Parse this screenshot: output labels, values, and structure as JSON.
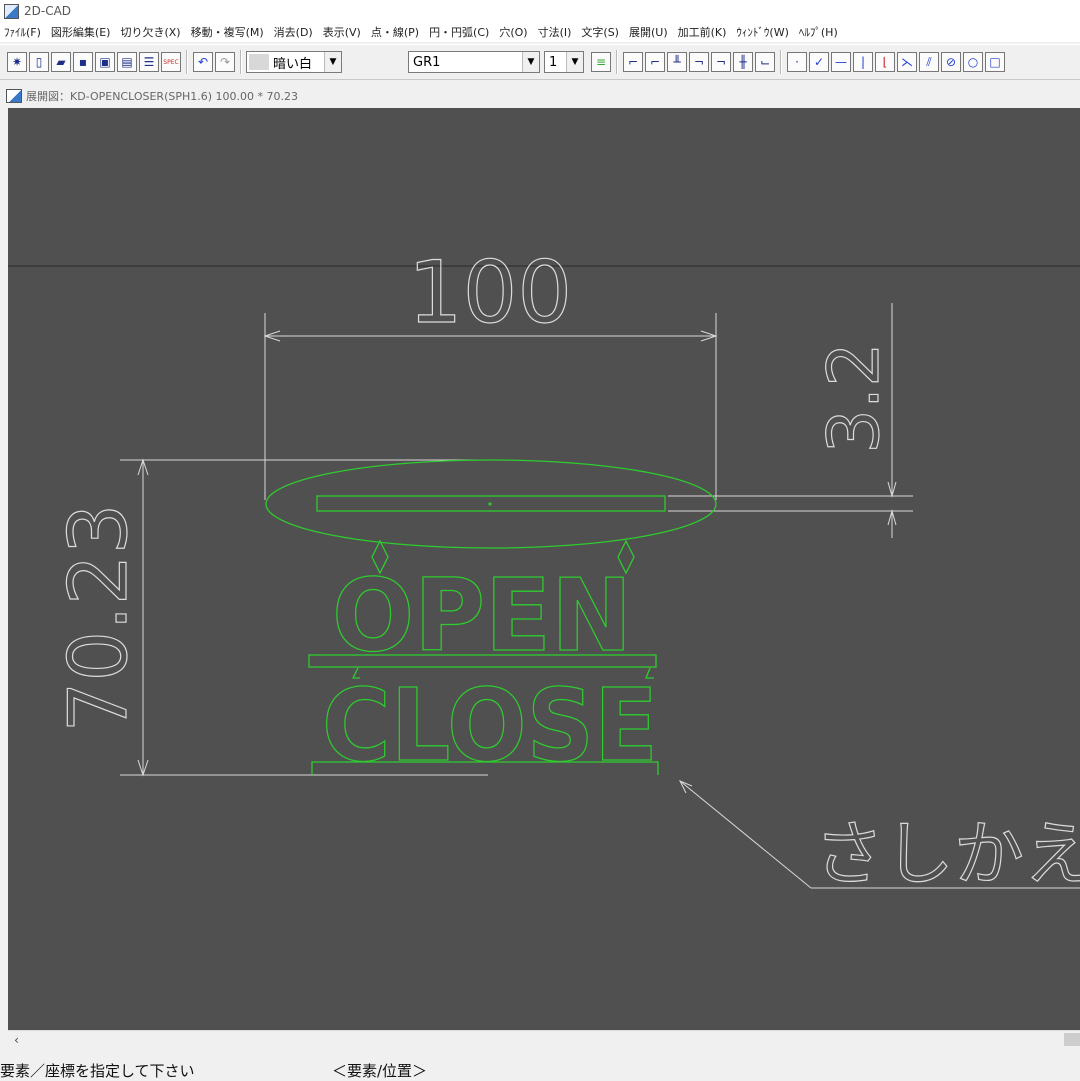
{
  "app": {
    "title": "2D-CAD"
  },
  "menu": [
    "ﾌｧｲﾙ(F)",
    "図形編集(E)",
    "切り欠き(X)",
    "移動・複写(M)",
    "消去(D)",
    "表示(V)",
    "点・線(P)",
    "円・円弧(C)",
    "穴(O)",
    "寸法(I)",
    "文字(S)",
    "展開(U)",
    "加工前(K)",
    "ｳｨﾝﾄﾞｳ(W)",
    "ﾍﾙﾌﾟ(H)"
  ],
  "toolbar": {
    "color_label": "暗い白",
    "layer_label": "GR1",
    "linetype_label": "1",
    "spec_label": "SPEC"
  },
  "document": {
    "title": "展開図：KD-OPENCLOSER(SPH1.6) 100.00 * 70.23"
  },
  "drawing": {
    "dim_width": "100",
    "dim_height": "70.23",
    "dim_thickness": "3.2",
    "sign_top_text": "OPEN",
    "sign_bottom_text": "CLOSE",
    "note_text": "さしかえて使",
    "colors": {
      "background": "#505050",
      "part": "#2ecc2e",
      "dimension": "#dcdcdc"
    }
  },
  "status": {
    "prompt": "要素／座標を指定して下さい",
    "mode": "＜要素/位置＞"
  }
}
